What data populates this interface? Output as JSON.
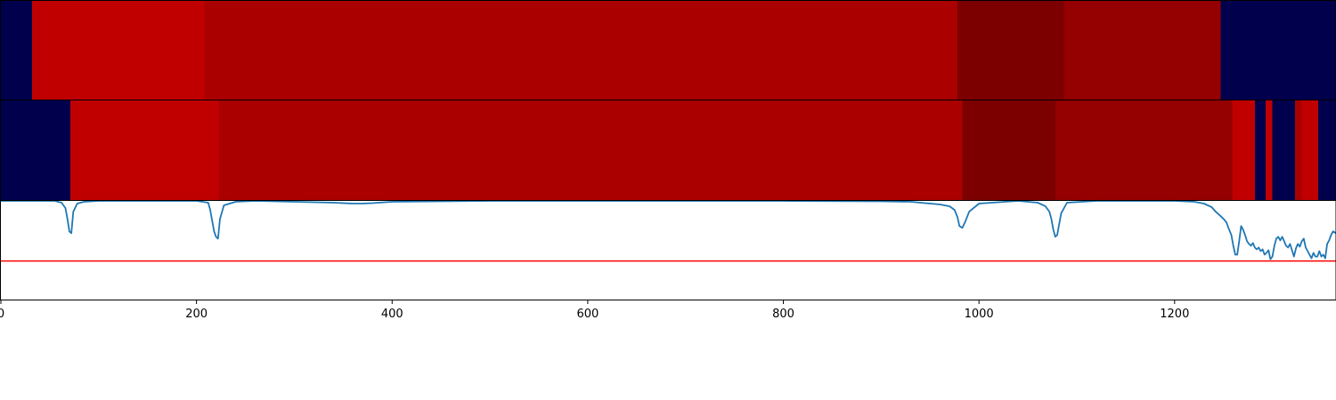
{
  "chart_data": [
    {
      "type": "heatmap",
      "panel": "top",
      "segments": [
        {
          "start": 0,
          "end": 32,
          "color": "#00004c"
        },
        {
          "start": 32,
          "end": 208,
          "color": "#c00000"
        },
        {
          "start": 208,
          "end": 978,
          "color": "#aa0000"
        },
        {
          "start": 978,
          "end": 1087,
          "color": "#7c0000"
        },
        {
          "start": 1087,
          "end": 1247,
          "color": "#950000"
        },
        {
          "start": 1247,
          "end": 1365,
          "color": "#00004c"
        }
      ]
    },
    {
      "type": "heatmap",
      "panel": "middle",
      "segments": [
        {
          "start": 0,
          "end": 71,
          "color": "#00004c"
        },
        {
          "start": 71,
          "end": 223,
          "color": "#c00000"
        },
        {
          "start": 223,
          "end": 983,
          "color": "#aa0000"
        },
        {
          "start": 983,
          "end": 1078,
          "color": "#7c0000"
        },
        {
          "start": 1078,
          "end": 1259,
          "color": "#950000"
        },
        {
          "start": 1259,
          "end": 1282,
          "color": "#c00000"
        },
        {
          "start": 1282,
          "end": 1293,
          "color": "#00004c"
        },
        {
          "start": 1293,
          "end": 1300,
          "color": "#c00000"
        },
        {
          "start": 1300,
          "end": 1302,
          "color": "#00004c"
        },
        {
          "start": 1302,
          "end": 1323,
          "color": "#00004c"
        },
        {
          "start": 1323,
          "end": 1330,
          "color": "#aa0000"
        },
        {
          "start": 1330,
          "end": 1347,
          "color": "#c00000"
        },
        {
          "start": 1347,
          "end": 1365,
          "color": "#00004c"
        }
      ]
    },
    {
      "type": "line",
      "panel": "bottom",
      "xlim": [
        0,
        1365
      ],
      "ylim": [
        -0.1,
        1.0
      ],
      "threshold": 0.33,
      "line_color": "#1f77b4",
      "threshold_color": "#ff0000",
      "x": [
        0,
        55,
        62,
        66,
        68,
        70,
        72,
        74,
        78,
        85,
        100,
        150,
        200,
        212,
        214,
        216,
        218,
        220,
        222,
        224,
        228,
        240,
        260,
        300,
        340,
        360,
        370,
        380,
        400,
        500,
        600,
        700,
        800,
        900,
        930,
        960,
        970,
        975,
        978,
        980,
        983,
        986,
        990,
        1000,
        1040,
        1060,
        1068,
        1072,
        1074,
        1076,
        1078,
        1080,
        1084,
        1090,
        1120,
        1200,
        1220,
        1230,
        1238,
        1242,
        1246,
        1250,
        1253,
        1255,
        1258,
        1260,
        1262,
        1264,
        1266,
        1268,
        1270,
        1272,
        1274,
        1276,
        1278,
        1280,
        1282,
        1284,
        1286,
        1288,
        1290,
        1292,
        1294,
        1296,
        1298,
        1300,
        1302,
        1304,
        1306,
        1308,
        1310,
        1312,
        1314,
        1316,
        1318,
        1320,
        1322,
        1324,
        1326,
        1328,
        1330,
        1332,
        1334,
        1336,
        1338,
        1340,
        1342,
        1344,
        1346,
        1348,
        1350,
        1352,
        1354,
        1356,
        1358,
        1360,
        1362,
        1365
      ],
      "y": [
        1.0,
        1.0,
        0.98,
        0.92,
        0.8,
        0.66,
        0.64,
        0.88,
        0.97,
        0.99,
        1.0,
        1.0,
        1.0,
        0.98,
        0.9,
        0.78,
        0.66,
        0.6,
        0.58,
        0.8,
        0.95,
        0.99,
        1.0,
        0.99,
        0.98,
        0.97,
        0.97,
        0.975,
        0.99,
        1.0,
        1.0,
        1.0,
        1.0,
        0.995,
        0.99,
        0.96,
        0.94,
        0.9,
        0.82,
        0.72,
        0.7,
        0.77,
        0.88,
        0.97,
        1.0,
        0.98,
        0.94,
        0.88,
        0.8,
        0.68,
        0.6,
        0.62,
        0.86,
        0.98,
        1.0,
        1.0,
        0.99,
        0.97,
        0.93,
        0.88,
        0.84,
        0.8,
        0.76,
        0.7,
        0.62,
        0.5,
        0.4,
        0.4,
        0.55,
        0.72,
        0.68,
        0.62,
        0.55,
        0.52,
        0.5,
        0.53,
        0.48,
        0.46,
        0.48,
        0.44,
        0.46,
        0.4,
        0.42,
        0.45,
        0.35,
        0.38,
        0.5,
        0.58,
        0.6,
        0.56,
        0.6,
        0.55,
        0.5,
        0.48,
        0.52,
        0.45,
        0.38,
        0.47,
        0.52,
        0.49,
        0.55,
        0.58,
        0.48,
        0.44,
        0.4,
        0.36,
        0.42,
        0.38,
        0.38,
        0.44,
        0.38,
        0.4,
        0.36,
        0.52,
        0.56,
        0.62,
        0.66,
        0.64
      ]
    }
  ],
  "x_axis": {
    "ticks": [
      0,
      200,
      400,
      600,
      800,
      1000,
      1200
    ],
    "tick_labels": [
      "0",
      "200",
      "400",
      "600",
      "800",
      "1000",
      "1200"
    ]
  }
}
